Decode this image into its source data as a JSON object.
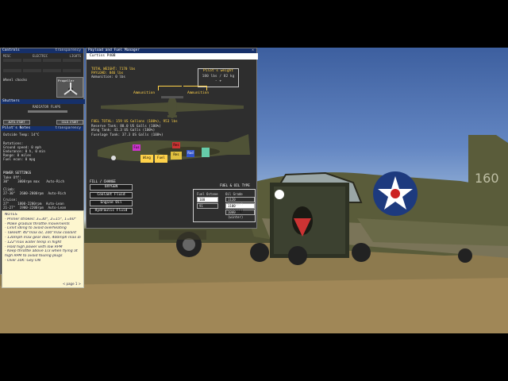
{
  "controls": {
    "title": "Controls",
    "transparency": "transparency",
    "col_heads": [
      "MISC",
      "ELECTRIC",
      "LIGHTS"
    ],
    "grid_labels": [
      "",
      "",
      "",
      "",
      "",
      "",
      "",
      "",
      "",
      "",
      "",
      ""
    ],
    "wheel_chocks": "Wheel chocks",
    "propeller_label": "Propeller",
    "section_shutters": "Shutters",
    "radiator_label": "RADIATOR FLAPS",
    "auto_start": "AUTO-START",
    "cold_start": "COLD-START"
  },
  "pilot_notes": {
    "title": "Pilot's Notes",
    "transparency": "transparency",
    "outside_temp": "Outside Temp: 14°C",
    "rotations_label": "Rotations:",
    "lines": [
      "Ground speed: 0 mph",
      "Endurance:     0 h, 0 min",
      "Range:         0 miles",
      "Fuel econ:     0 mpg"
    ],
    "power_settings": "POWER SETTINGS",
    "takeoff_label": "Take Off:",
    "takeoff_rows": [
      [
        "30\"",
        "3000rpm max",
        "Auto-Rich"
      ],
      [
        "27-30\"",
        "2600-2800rpm",
        "Auto-Rich"
      ]
    ],
    "climb_label": "Climb:",
    "cruise_label": "Cruise:",
    "cruise_rows": [
      [
        "27\"",
        "1800-2200rpm",
        "Auto-Lean"
      ],
      [
        "21-27\"",
        "1900-2200rpm",
        "Auto-Lean"
      ]
    ]
  },
  "notes": {
    "heading": "NOTES",
    "lines": [
      "- Primer strokes: 3=30°, 2=15°, 1=60°",
      "- Make gradual throttle movements",
      "- Limit idling to avoid overheating",
      "- Takeoff: 40\"max oil, 100°max coolant",
      "- 130mph max gear dwn, 400mph max dive",
      "- 122°max water temp in flight",
      "- Hold high power with low RPM",
      "- Keep throttle above 1/3 when flying at",
      "  high RPM to avoid fouling plugs",
      "- Over 10K: Gey ON"
    ],
    "page": "< page 1 >"
  },
  "payload": {
    "title": "Payload and Fuel Manager",
    "aircraft": "Curtiss P40B",
    "total_weight": "TOTAL WEIGHT: 7170 lbs",
    "payload": "PAYLOAD: 846 lbs",
    "ammunition_lbs": "Ammunition: 0 lbs",
    "pilot_weight_title": "Pilot's weight",
    "pilot_weight_value": "180 lbs / 82 kg",
    "pilot_weight_btns": "- +",
    "ammunition_left": "Ammunition",
    "ammunition_right": "Ammunition",
    "fuel_lines": [
      "FUEL TOTAL: 159 US Gallons (100%), 953 lbs",
      "Reserve Tank: 80.0 US Galls (100%)",
      "Wing Tank: 41.3 US Galls (100%)",
      "Fuselage Tank: 37.3 US Galls (100%)"
    ],
    "tank_markers": [
      "Fus",
      "Res",
      "Wing",
      "Fuel",
      "Res",
      "Rad"
    ],
    "fill_change": "FILL / CHANGE",
    "buttons": [
      "OXYGEN",
      "Coolant Fluid",
      "Engine Oil",
      "Hydraulic Fluid"
    ],
    "fuel_oil_type": "FUEL & OIL TYPE",
    "fuel_octane_label": "Fuel Octane",
    "fuel_octane_options": [
      "100",
      "91"
    ],
    "oil_grade_label": "Oil Grade",
    "oil_grade_options": [
      "1120 (summer)",
      "1100 (spring)",
      "1080 (winter)"
    ]
  },
  "colors": {
    "accent": "#ffd24a",
    "titlebar": "#16306a",
    "notes_bg": "#fdf6cf"
  }
}
